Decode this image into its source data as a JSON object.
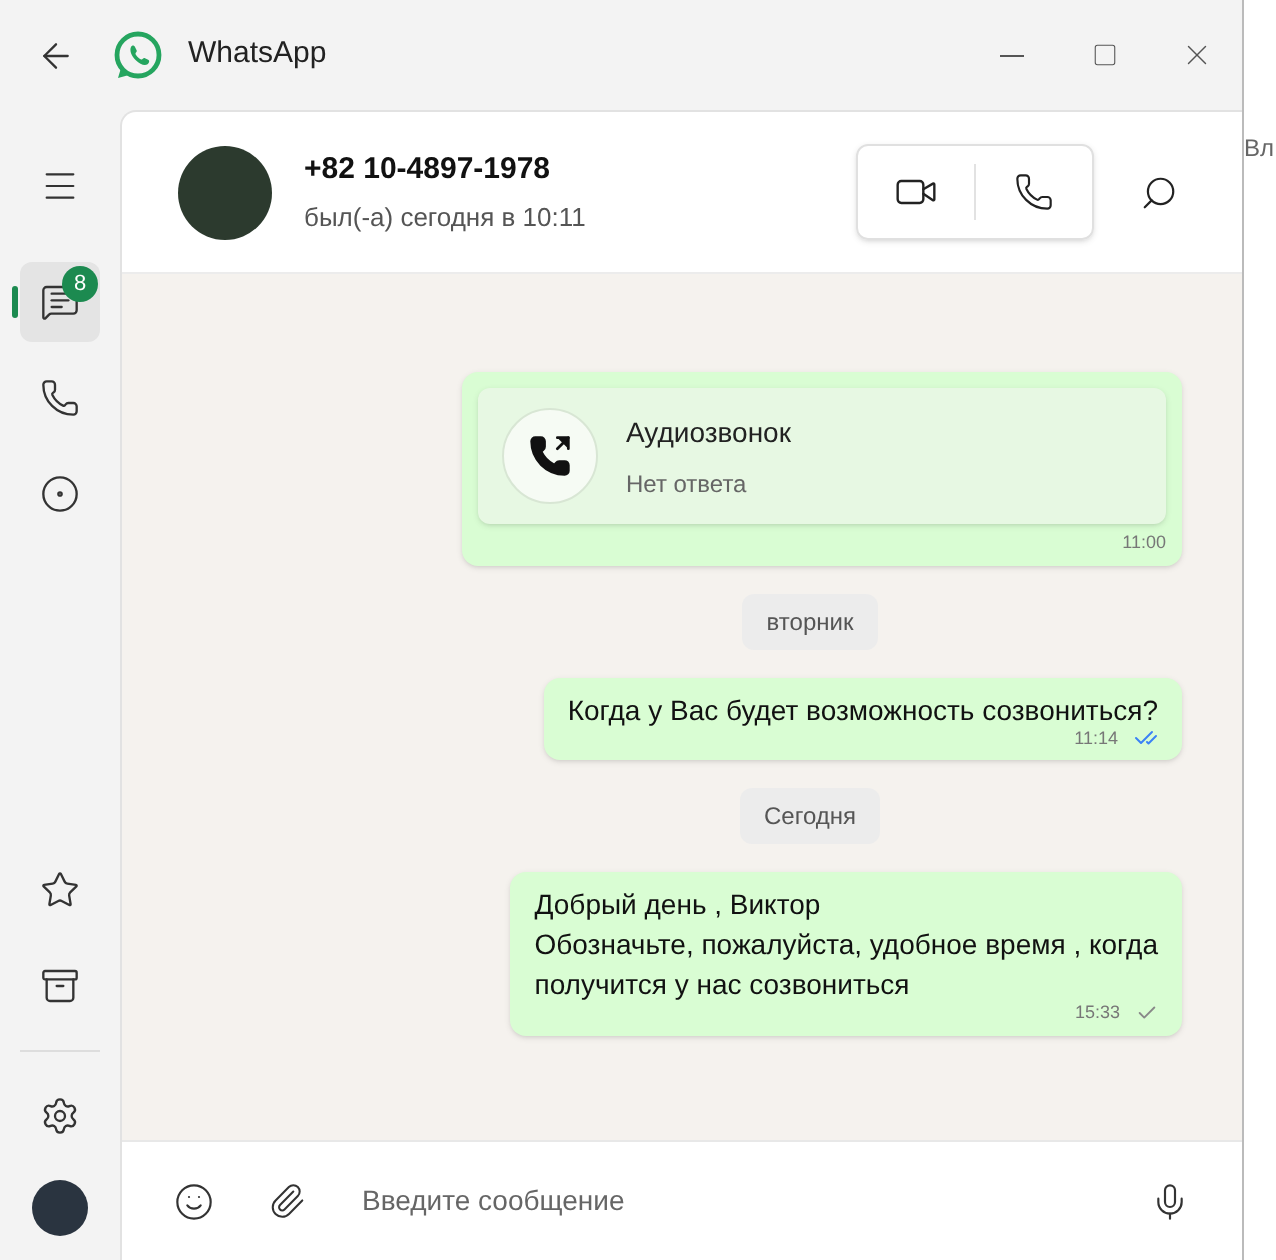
{
  "window": {
    "title": "WhatsApp"
  },
  "background_window": {
    "text": "Вл"
  },
  "sidebar": {
    "top_items": [
      {
        "kind": "chats",
        "selected": true,
        "badge": "8"
      },
      {
        "kind": "calls",
        "selected": false
      },
      {
        "kind": "status",
        "selected": false
      }
    ],
    "bottom_items": [
      {
        "kind": "starred",
        "selected": false
      },
      {
        "kind": "archive",
        "selected": false
      },
      {
        "kind": "settings",
        "selected": false
      }
    ]
  },
  "chat_header": {
    "name": "+82 10-4897-1978",
    "last_seen": "был(-а) сегодня в 10:11"
  },
  "messages": [
    {
      "kind": "call",
      "title": "Аудиозвонок",
      "subtitle": "Нет ответа",
      "time": "11:00"
    },
    {
      "kind": "date",
      "text": "вторник"
    },
    {
      "kind": "text",
      "lines": [
        "Когда у Вас будет возможность созвониться?"
      ],
      "time": "11:14",
      "read": true
    },
    {
      "kind": "date",
      "text": "Сегодня"
    },
    {
      "kind": "text",
      "lines": [
        "Добрый день , Виктор",
        "Обозначьте, пожалуйста, удобное время , когда",
        "получится у нас созвониться"
      ],
      "time": "15:33",
      "read": false
    }
  ],
  "composer": {
    "placeholder": "Введите сообщение"
  }
}
